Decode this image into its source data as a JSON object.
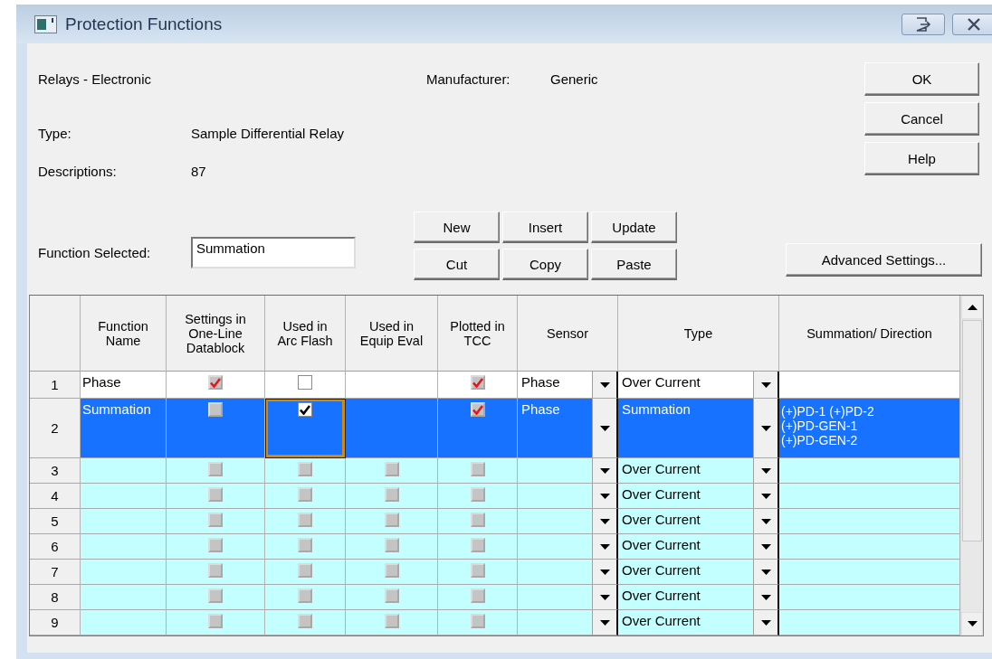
{
  "window": {
    "title": "Protection Functions"
  },
  "info": {
    "category": "Relays - Electronic",
    "manufacturer_label": "Manufacturer:",
    "manufacturer": "Generic",
    "type_label": "Type:",
    "type": "Sample Differential Relay",
    "descriptions_label": "Descriptions:",
    "descriptions": "87"
  },
  "dialog_buttons": [
    "OK",
    "Cancel",
    "Help"
  ],
  "function_selected": {
    "label": "Function Selected:",
    "value": "Summation"
  },
  "edit_buttons": [
    "New",
    "Insert",
    "Update",
    "Cut",
    "Copy",
    "Paste"
  ],
  "advanced_button": "Advanced Settings...",
  "grid": {
    "columns": [
      "Function\nName",
      "Settings in\nOne-Line\nDatablock",
      "Used in\nArc Flash",
      "Used in\nEquip Eval",
      "Plotted in\nTCC",
      "Sensor",
      "Type",
      "Summation/ Direction"
    ],
    "rows": [
      {
        "number": "1",
        "selected": false,
        "name": "Phase",
        "cells": [
          {
            "checked": true,
            "disabled": true,
            "focused": false
          },
          {
            "checked": false,
            "disabled": false,
            "focused": false
          },
          null,
          {
            "checked": true,
            "disabled": true,
            "focused": false
          }
        ],
        "sensor": "Phase",
        "type": "Over Current"
      },
      {
        "number": "2",
        "selected": true,
        "name": "Summation",
        "cells": [
          {
            "checked": false,
            "disabled": true,
            "focused": false
          },
          {
            "checked": true,
            "disabled": false,
            "focused": true
          },
          null,
          {
            "checked": true,
            "disabled": true,
            "focused": false
          }
        ],
        "sensor": "Phase",
        "type": "Summation",
        "summation": "(+)PD-1 (+)PD-2\n(+)PD-GEN-1\n(+)PD-GEN-2"
      },
      {
        "number": "3",
        "selected": false,
        "cells": [
          {
            "checked": false,
            "disabled": true,
            "focused": false
          },
          {
            "checked": false,
            "disabled": true,
            "focused": false
          },
          {
            "checked": false,
            "disabled": true,
            "focused": false
          },
          {
            "checked": false,
            "disabled": true,
            "focused": false
          }
        ],
        "type": "Over Current"
      },
      {
        "number": "4",
        "selected": false,
        "cells": [
          {
            "checked": false,
            "disabled": true,
            "focused": false
          },
          {
            "checked": false,
            "disabled": true,
            "focused": false
          },
          {
            "checked": false,
            "disabled": true,
            "focused": false
          },
          {
            "checked": false,
            "disabled": true,
            "focused": false
          }
        ],
        "type": "Over Current"
      },
      {
        "number": "5",
        "selected": false,
        "cells": [
          {
            "checked": false,
            "disabled": true,
            "focused": false
          },
          {
            "checked": false,
            "disabled": true,
            "focused": false
          },
          {
            "checked": false,
            "disabled": true,
            "focused": false
          },
          {
            "checked": false,
            "disabled": true,
            "focused": false
          }
        ],
        "type": "Over Current"
      },
      {
        "number": "6",
        "selected": false,
        "cells": [
          {
            "checked": false,
            "disabled": true,
            "focused": false
          },
          {
            "checked": false,
            "disabled": true,
            "focused": false
          },
          {
            "checked": false,
            "disabled": true,
            "focused": false
          },
          {
            "checked": false,
            "disabled": true,
            "focused": false
          }
        ],
        "type": "Over Current"
      },
      {
        "number": "7",
        "selected": false,
        "cells": [
          {
            "checked": false,
            "disabled": true,
            "focused": false
          },
          {
            "checked": false,
            "disabled": true,
            "focused": false
          },
          {
            "checked": false,
            "disabled": true,
            "focused": false
          },
          {
            "checked": false,
            "disabled": true,
            "focused": false
          }
        ],
        "type": "Over Current"
      },
      {
        "number": "8",
        "selected": false,
        "cells": [
          {
            "checked": false,
            "disabled": true,
            "focused": false
          },
          {
            "checked": false,
            "disabled": true,
            "focused": false
          },
          {
            "checked": false,
            "disabled": true,
            "focused": false
          },
          {
            "checked": false,
            "disabled": true,
            "focused": false
          }
        ],
        "type": "Over Current"
      },
      {
        "number": "9",
        "selected": false,
        "cells": [
          {
            "checked": false,
            "disabled": true,
            "focused": false
          },
          {
            "checked": false,
            "disabled": true,
            "focused": false
          },
          {
            "checked": false,
            "disabled": true,
            "focused": false
          },
          {
            "checked": false,
            "disabled": true,
            "focused": false
          }
        ],
        "type": "Over Current"
      }
    ]
  }
}
